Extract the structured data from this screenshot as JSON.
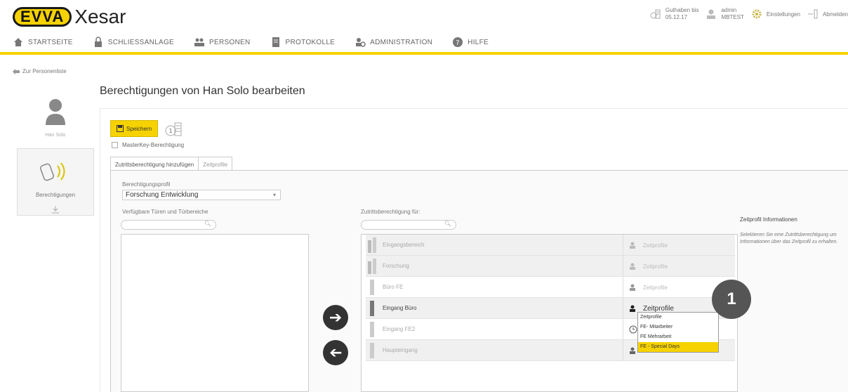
{
  "app": {
    "logo_badge": "EVVA",
    "logo_text": "Xesar"
  },
  "topbar": {
    "credit_label": "Guthaben bis",
    "credit_date": "05.12.17",
    "user_name": "admin",
    "user_tenant": "MBTEST",
    "settings_label": "Einstellungen",
    "logout_label": "Abmelden"
  },
  "nav": {
    "items": [
      {
        "label": "Startseite",
        "icon": "home-icon"
      },
      {
        "label": "Schließanlage",
        "icon": "lock-icon"
      },
      {
        "label": "Personen",
        "icon": "people-icon"
      },
      {
        "label": "Protokolle",
        "icon": "document-icon"
      },
      {
        "label": "Administration",
        "icon": "admin-icon"
      },
      {
        "label": "Hilfe",
        "icon": "help-icon"
      }
    ]
  },
  "back_link": "Zur Personenliste",
  "page_title": "Berechtigungen von Han Solo bearbeiten",
  "person": {
    "name": "Han Solo"
  },
  "side_tab": {
    "label": "Berechtigungen"
  },
  "toolbar": {
    "save_label": "Speichern",
    "credit_count": "1"
  },
  "masterkey_label": "MasterKey-Berechtigung",
  "tabs": [
    {
      "label": "Zutrittsberechtigung hinzufügen"
    },
    {
      "label": "Zeitprofile"
    }
  ],
  "form": {
    "profile_label": "Berechtigungsprofil",
    "profile_value": "Forschung Entwicklung",
    "available_label": "Verfügbare Türen und Türbereiche",
    "granted_label": "Zutrittsberechtigung für:"
  },
  "doors": [
    {
      "name": "Eingangsbereich",
      "profile": "Zeitprofile",
      "active": false
    },
    {
      "name": "Forschung",
      "profile": "Zeitprofile",
      "active": false
    },
    {
      "name": "Büro FE",
      "profile": "Zeitprofile",
      "active": false
    },
    {
      "name": "Eingang Büro",
      "profile": "Zeitprofile",
      "active": true
    },
    {
      "name": "Eingang FE2",
      "profile": "",
      "active": false
    },
    {
      "name": "Haupteingang",
      "profile": "",
      "active": false
    }
  ],
  "dropdown": {
    "options": [
      "Zeitprofile",
      "FE- Mitarbeiter",
      "FE Mehrarbeit",
      "FE - Special Days"
    ],
    "selected": "FE - Special Days"
  },
  "callout_number": "1",
  "info": {
    "title": "Zeitprofil Informationen",
    "text": "Selektieren Sie eine Zutrittsberechtigung um Informationen über das Zeitprofil zu erhalten."
  },
  "colors": {
    "accent": "#f6d200",
    "dark": "#333333"
  }
}
